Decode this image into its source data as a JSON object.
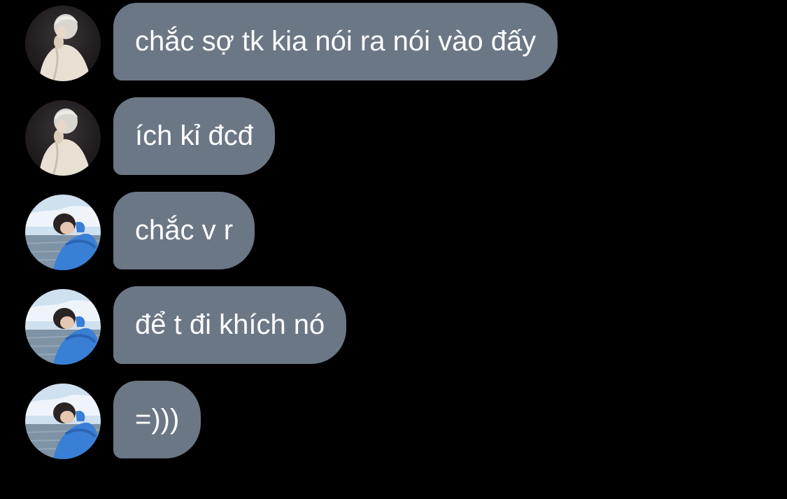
{
  "messages": [
    {
      "avatar": "avatar-white-hair-icon",
      "text": "chắc sợ tk kia nói ra nói vào đấy"
    },
    {
      "avatar": "avatar-white-hair-icon",
      "text": "ích kỉ đcđ"
    },
    {
      "avatar": "avatar-blue-shirt-icon",
      "text": "chắc v r"
    },
    {
      "avatar": "avatar-blue-shirt-icon",
      "text": "để t đi khích nó"
    },
    {
      "avatar": "avatar-blue-shirt-icon",
      "text": "=)))"
    }
  ],
  "colors": {
    "background": "#000000",
    "bubble": "#6b7785",
    "text": "#ffffff"
  }
}
